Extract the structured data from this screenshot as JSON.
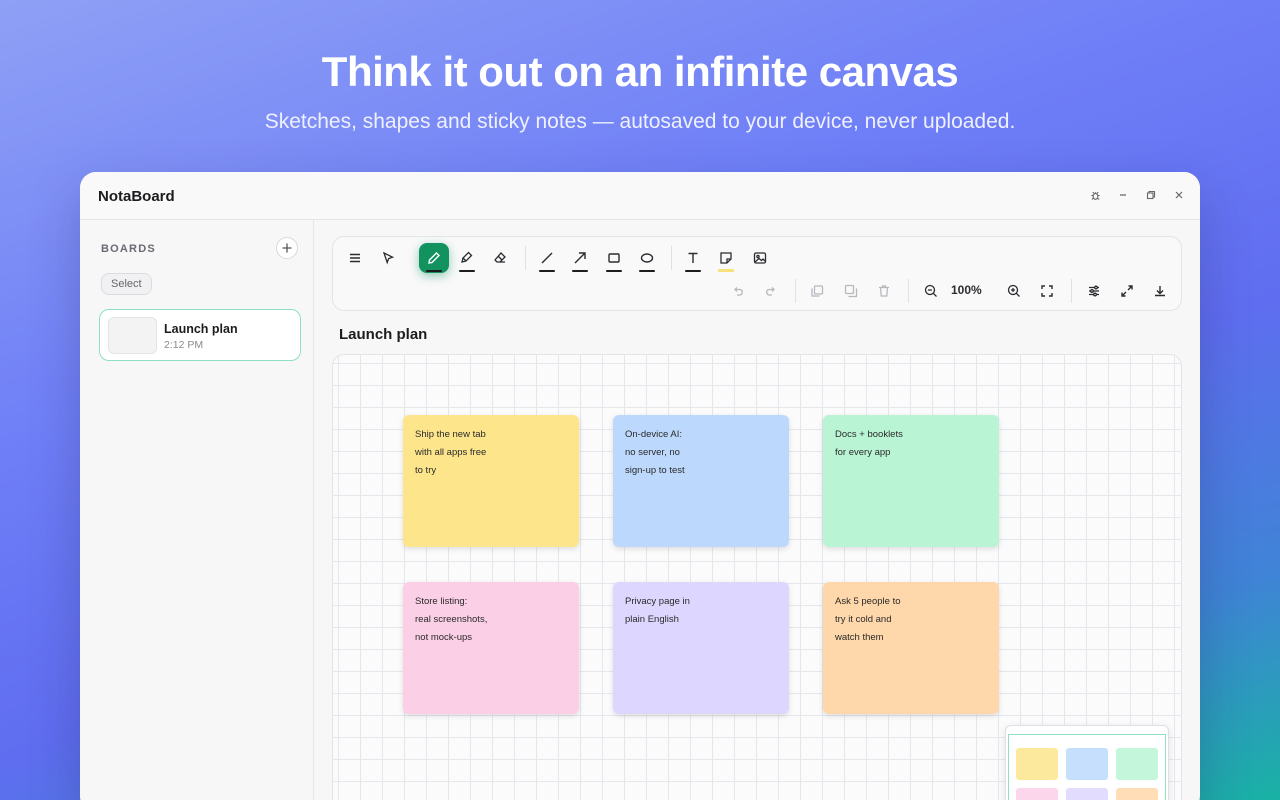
{
  "hero": {
    "title": "Think it out on an infinite canvas",
    "subtitle": "Sketches, shapes and sticky notes — autosaved to your device, never uploaded."
  },
  "window": {
    "app_name": "NotaBoard",
    "controls": [
      "bug-icon",
      "minimize-icon",
      "restore-icon",
      "close-icon"
    ]
  },
  "sidebar": {
    "section_label": "BOARDS",
    "select_label": "Select",
    "boards": [
      {
        "name": "Launch plan",
        "time": "2:12 PM"
      }
    ]
  },
  "toolbar": {
    "tools": [
      "menu-icon",
      "select-icon",
      "pen-icon",
      "highlighter-icon",
      "eraser-icon",
      "line-icon",
      "arrow-icon",
      "rectangle-icon",
      "ellipse-icon",
      "text-icon",
      "sticky-note-icon",
      "image-icon"
    ],
    "active_tool": "pen",
    "actions": [
      "undo-icon",
      "redo-icon",
      "duplicate-icon",
      "copy-icon",
      "delete-icon",
      "zoom-out-icon",
      "zoom-in-icon",
      "fit-icon",
      "settings-icon",
      "fullscreen-icon",
      "download-icon"
    ],
    "zoom": "100%"
  },
  "board": {
    "title": "Launch plan",
    "notes": [
      {
        "lines": [
          "Ship the new tab",
          "with all apps free",
          "to try"
        ],
        "color": "#fde58c"
      },
      {
        "lines": [
          "On-device AI:",
          "no server, no",
          "sign-up to test"
        ],
        "color": "#bcd9fd"
      },
      {
        "lines": [
          "Docs + booklets",
          "for every app"
        ],
        "color": "#b9f5d4"
      },
      {
        "lines": [
          "Store listing:",
          "real screenshots,",
          "not mock-ups"
        ],
        "color": "#fbcfe6"
      },
      {
        "lines": [
          "Privacy page in",
          "plain English"
        ],
        "color": "#ddd6fe"
      },
      {
        "lines": [
          "Ask 5 people to",
          "try it cold and",
          "watch them"
        ],
        "color": "#fed7aa"
      }
    ]
  },
  "colors": {
    "accent": "#12925f",
    "selection": "#8fe0c3"
  }
}
